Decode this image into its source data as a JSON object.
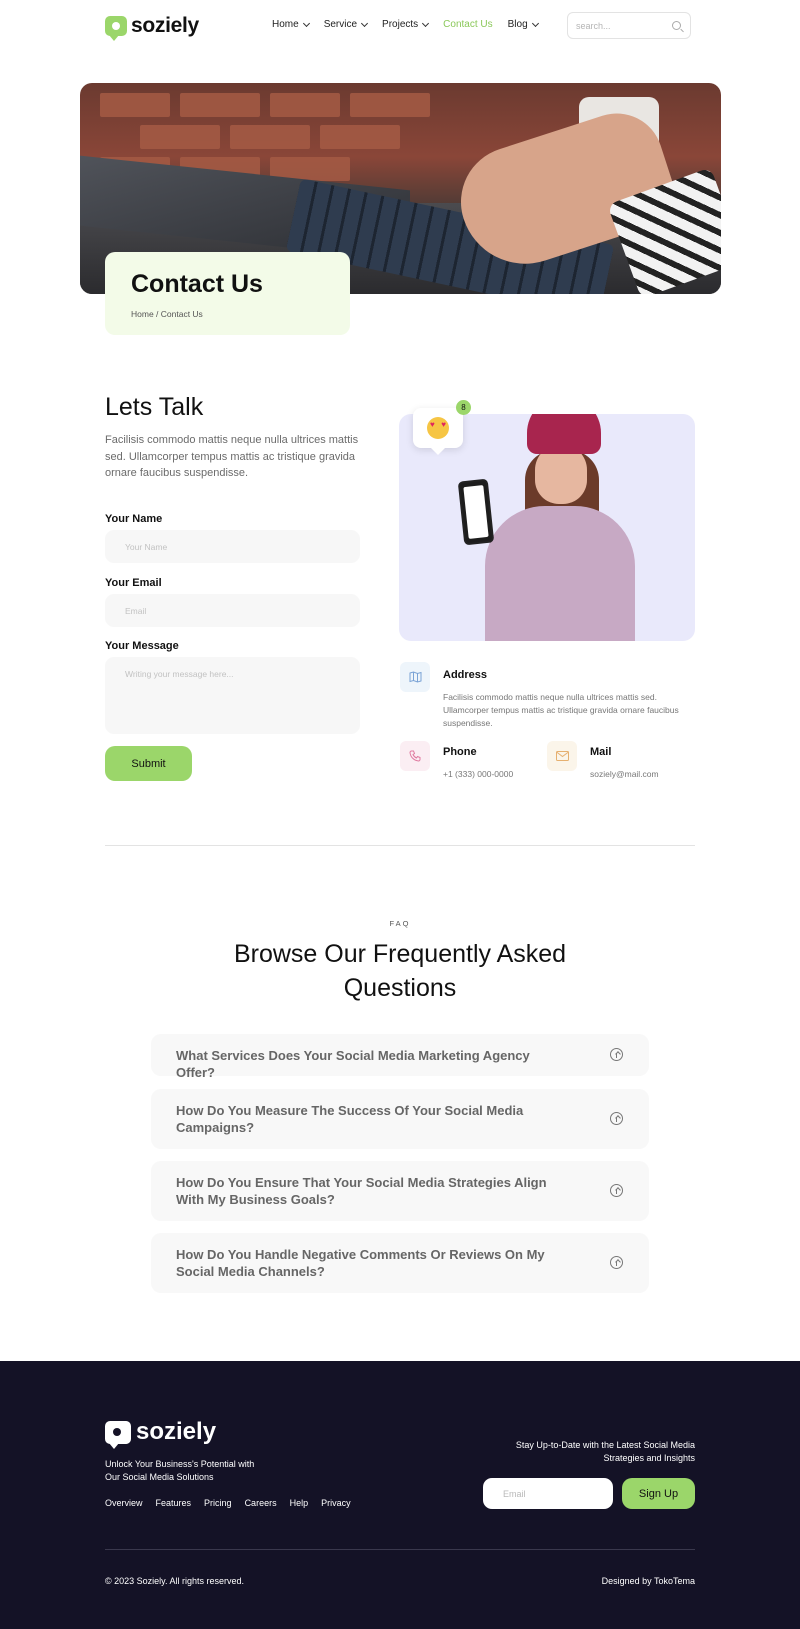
{
  "header": {
    "logo_text": "soziely",
    "nav": [
      {
        "label": "Home",
        "has_dropdown": true
      },
      {
        "label": "Service",
        "has_dropdown": true
      },
      {
        "label": "Projects",
        "has_dropdown": true
      },
      {
        "label": "Contact Us",
        "has_dropdown": false,
        "active": true
      },
      {
        "label": "Blog",
        "has_dropdown": true
      }
    ],
    "search_placeholder": "search..."
  },
  "hero": {
    "title": "Contact Us",
    "breadcrumb": "Home / Contact Us"
  },
  "contact_form": {
    "title": "Lets Talk",
    "description": "Facilisis commodo mattis neque nulla ultrices mattis sed. Ullamcorper tempus mattis ac tristique gravida ornare faucibus suspendisse.",
    "name_label": "Your Name",
    "name_placeholder": "Your Name",
    "email_label": "Your Email",
    "email_placeholder": "Email",
    "message_label": "Your Message",
    "message_placeholder": "Writing your message here...",
    "submit_label": "Submit"
  },
  "photo": {
    "notification_count": "8"
  },
  "contact_info": {
    "address_title": "Address",
    "address_text": "Facilisis commodo mattis neque nulla ultrices mattis sed. Ullamcorper tempus mattis ac tristique gravida ornare faucibus suspendisse.",
    "phone_title": "Phone",
    "phone_text": "+1 (333) 000-0000",
    "mail_title": "Mail",
    "mail_text": "soziely@mail.com"
  },
  "faq": {
    "eyebrow": "FAQ",
    "title": "Browse Our Frequently Asked Questions",
    "items": [
      {
        "question": "What Services Does Your Social Media Marketing Agency Offer?"
      },
      {
        "question": "How Do You Measure The Success Of Your Social Media Campaigns?"
      },
      {
        "question": "How Do You Ensure That Your Social Media Strategies Align With My Business Goals?"
      },
      {
        "question": "How Do You Handle Negative Comments Or Reviews On My Social Media Channels?"
      }
    ]
  },
  "footer": {
    "logo_text": "soziely",
    "tagline": "Unlock Your Business's Potential with Our Social Media Solutions",
    "links": [
      "Overview",
      "Features",
      "Pricing",
      "Careers",
      "Help",
      "Privacy"
    ],
    "newsletter_text": "Stay Up-to-Date with the Latest Social Media Strategies and Insights",
    "email_placeholder": "Email",
    "signup_label": "Sign Up",
    "copyright": "© 2023 Soziely. All rights reserved.",
    "designed_by": "Designed by TokoTema"
  },
  "colors": {
    "accent": "#9bd66a",
    "footer_bg": "#141226",
    "title_card_bg": "#f3fbe8",
    "photo_bg": "#e9e9fb"
  }
}
